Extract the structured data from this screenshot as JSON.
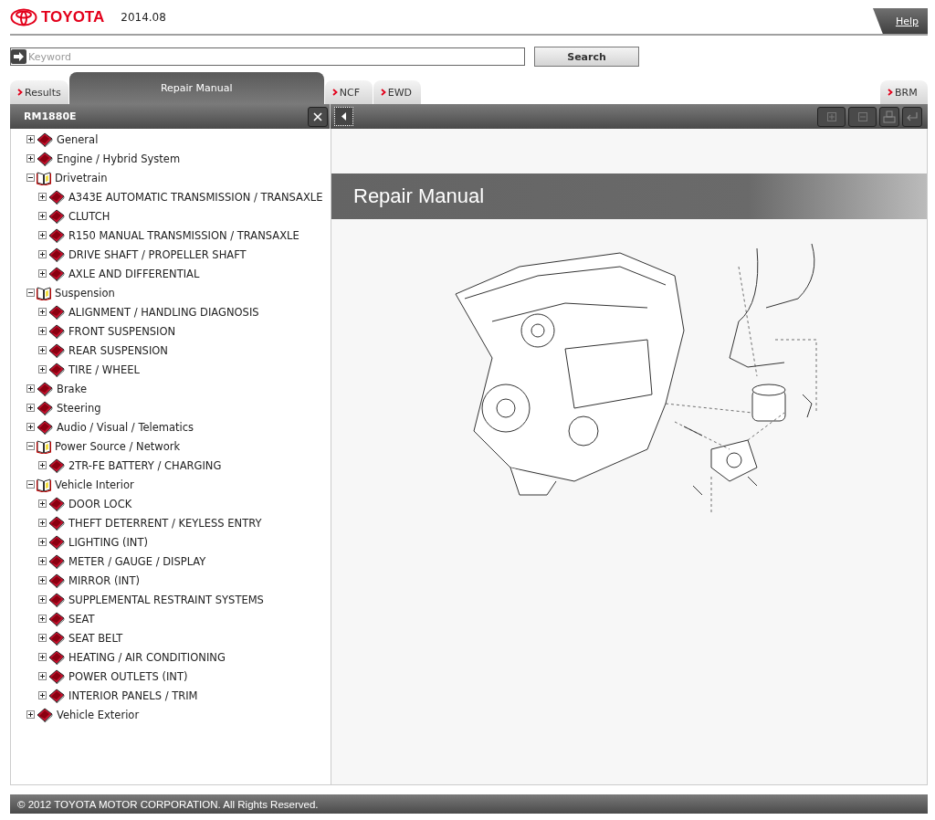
{
  "header": {
    "brand": "TOYOTA",
    "version": "2014.08",
    "help": "Help"
  },
  "search": {
    "placeholder": "Keyword",
    "button": "Search"
  },
  "tabs": [
    {
      "label": "Results",
      "selected": false
    },
    {
      "label": "Repair Manual",
      "selected": true
    },
    {
      "label": "NCF",
      "selected": false
    },
    {
      "label": "EWD",
      "selected": false
    }
  ],
  "right_tabs": [
    {
      "label": "BRM",
      "selected": false
    }
  ],
  "panel": {
    "title": "RM1880E"
  },
  "tree": [
    {
      "label": "General",
      "expanded": false
    },
    {
      "label": "Engine / Hybrid System",
      "expanded": false
    },
    {
      "label": "Drivetrain",
      "expanded": true,
      "children": [
        {
          "label": "A343E AUTOMATIC TRANSMISSION / TRANSAXLE",
          "expanded": false
        },
        {
          "label": "CLUTCH",
          "expanded": false
        },
        {
          "label": "R150 MANUAL TRANSMISSION / TRANSAXLE",
          "expanded": false
        },
        {
          "label": "DRIVE SHAFT / PROPELLER SHAFT",
          "expanded": false
        },
        {
          "label": "AXLE AND DIFFERENTIAL",
          "expanded": false
        }
      ]
    },
    {
      "label": "Suspension",
      "expanded": true,
      "children": [
        {
          "label": "ALIGNMENT / HANDLING DIAGNOSIS",
          "expanded": false
        },
        {
          "label": "FRONT SUSPENSION",
          "expanded": false
        },
        {
          "label": "REAR SUSPENSION",
          "expanded": false
        },
        {
          "label": "TIRE / WHEEL",
          "expanded": false
        }
      ]
    },
    {
      "label": "Brake",
      "expanded": false
    },
    {
      "label": "Steering",
      "expanded": false
    },
    {
      "label": "Audio / Visual / Telematics",
      "expanded": false
    },
    {
      "label": "Power Source / Network",
      "expanded": true,
      "children": [
        {
          "label": "2TR-FE BATTERY / CHARGING",
          "expanded": false
        }
      ]
    },
    {
      "label": "Vehicle Interior",
      "expanded": true,
      "children": [
        {
          "label": "DOOR LOCK",
          "expanded": false
        },
        {
          "label": "THEFT DETERRENT / KEYLESS ENTRY",
          "expanded": false
        },
        {
          "label": "LIGHTING (INT)",
          "expanded": false
        },
        {
          "label": "METER / GAUGE / DISPLAY",
          "expanded": false
        },
        {
          "label": "MIRROR (INT)",
          "expanded": false
        },
        {
          "label": "SUPPLEMENTAL RESTRAINT SYSTEMS",
          "expanded": false
        },
        {
          "label": "SEAT",
          "expanded": false
        },
        {
          "label": "SEAT BELT",
          "expanded": false
        },
        {
          "label": "HEATING / AIR CONDITIONING",
          "expanded": false
        },
        {
          "label": "POWER OUTLETS (INT)",
          "expanded": false
        },
        {
          "label": "INTERIOR PANELS / TRIM",
          "expanded": false
        }
      ]
    },
    {
      "label": "Vehicle Exterior",
      "expanded": false
    }
  ],
  "content": {
    "title": "Repair Manual"
  },
  "footer": {
    "copyright": "© 2012 TOYOTA MOTOR CORPORATION. All Rights Reserved."
  }
}
